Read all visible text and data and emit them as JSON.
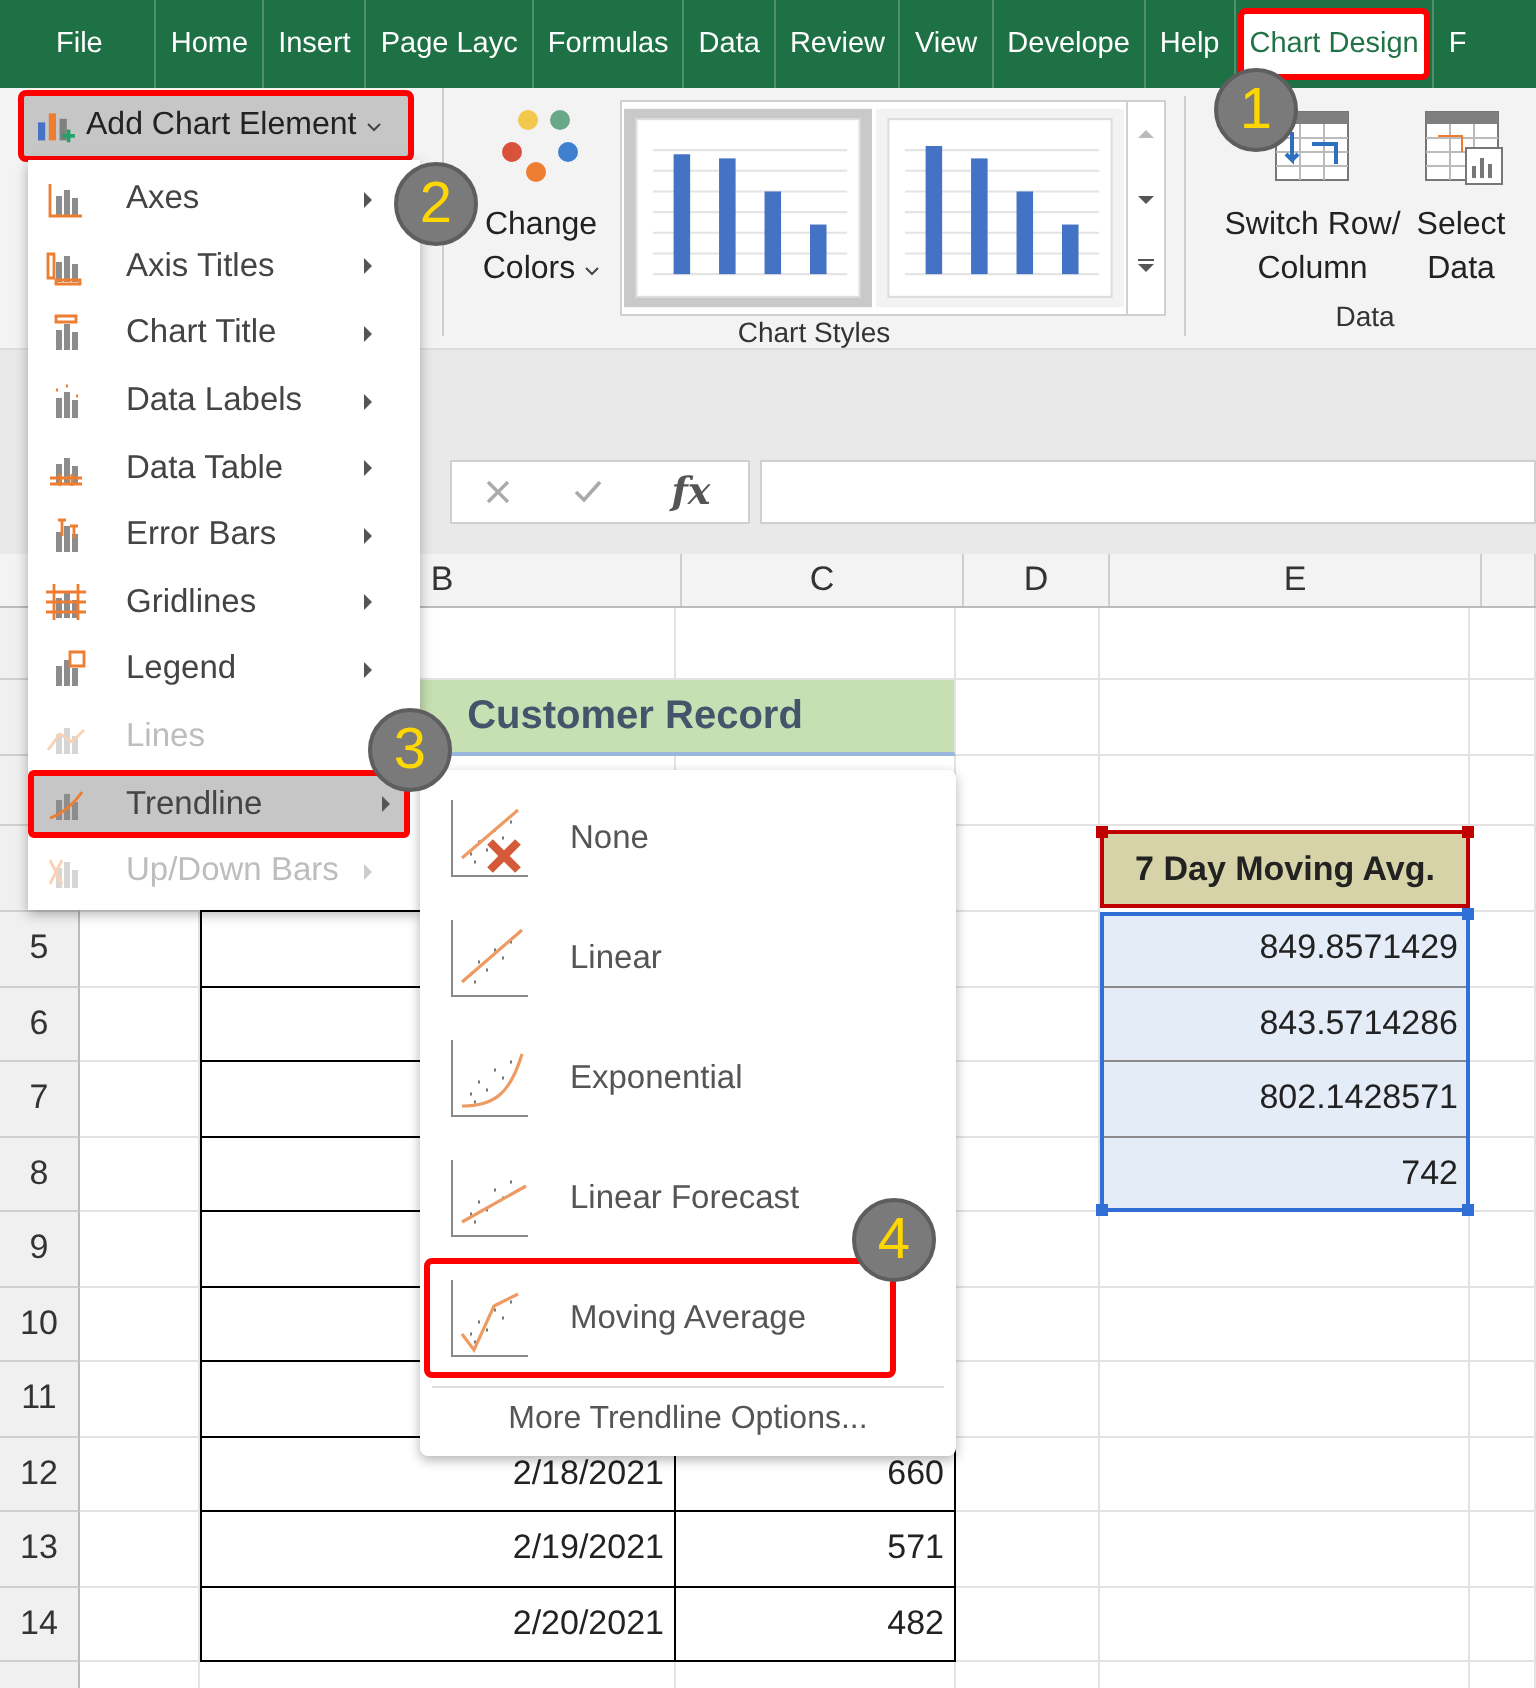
{
  "ribbon_tabs": [
    {
      "label": "File",
      "selected": false,
      "highlighted": false
    },
    {
      "label": "Home",
      "selected": false,
      "highlighted": false
    },
    {
      "label": "Insert",
      "selected": false,
      "highlighted": false
    },
    {
      "label": "Page Layc",
      "selected": false,
      "highlighted": false
    },
    {
      "label": "Formulas",
      "selected": false,
      "highlighted": false
    },
    {
      "label": "Data",
      "selected": false,
      "highlighted": false
    },
    {
      "label": "Review",
      "selected": false,
      "highlighted": false
    },
    {
      "label": "View",
      "selected": false,
      "highlighted": false
    },
    {
      "label": "Develope",
      "selected": false,
      "highlighted": false
    },
    {
      "label": "Help",
      "selected": false,
      "highlighted": false
    },
    {
      "label": "Chart Design",
      "selected": true,
      "highlighted": true
    },
    {
      "label": "F",
      "selected": false,
      "highlighted": false
    }
  ],
  "ribbon": {
    "add_chart_element": {
      "label": "Add Chart Element",
      "highlighted": true
    },
    "change_colors": {
      "label_lines": [
        "Change",
        "Colors"
      ]
    },
    "chart_styles": {
      "label": "Chart Styles",
      "styles": [
        {
          "selected": true
        },
        {
          "selected": false
        }
      ]
    },
    "data_group": {
      "label": "Data",
      "buttons": [
        {
          "label_lines": [
            "Switch Row/",
            "Column"
          ]
        },
        {
          "label_lines": [
            "Select",
            "Data"
          ]
        }
      ]
    }
  },
  "formula_bar": {
    "function_label": "fx"
  },
  "sheet": {
    "columns": [
      "B",
      "C",
      "D",
      "E"
    ],
    "title": "Customer Record",
    "avg_header": "7 Day Moving Avg.",
    "rows": [
      {
        "row": "5",
        "E": "849.8571429"
      },
      {
        "row": "6",
        "E": "843.5714286"
      },
      {
        "row": "7",
        "E": "802.1428571"
      },
      {
        "row": "8",
        "E": "742"
      },
      {
        "row": "9"
      },
      {
        "row": "10"
      },
      {
        "row": "11"
      },
      {
        "row": "12",
        "B": "2/18/2021",
        "C": "660"
      },
      {
        "row": "13",
        "B": "2/19/2021",
        "C": "571"
      },
      {
        "row": "14",
        "B": "2/20/2021",
        "C": "482"
      }
    ]
  },
  "add_chart_element_menu": {
    "items": [
      {
        "label": "Axes",
        "disabled": false,
        "selected": false,
        "has_submenu": true
      },
      {
        "label": "Axis Titles",
        "disabled": false,
        "selected": false,
        "has_submenu": true
      },
      {
        "label": "Chart Title",
        "disabled": false,
        "selected": false,
        "has_submenu": true
      },
      {
        "label": "Data Labels",
        "disabled": false,
        "selected": false,
        "has_submenu": true
      },
      {
        "label": "Data Table",
        "disabled": false,
        "selected": false,
        "has_submenu": true
      },
      {
        "label": "Error Bars",
        "disabled": false,
        "selected": false,
        "has_submenu": true
      },
      {
        "label": "Gridlines",
        "disabled": false,
        "selected": false,
        "has_submenu": true
      },
      {
        "label": "Legend",
        "disabled": false,
        "selected": false,
        "has_submenu": true
      },
      {
        "label": "Lines",
        "disabled": true,
        "selected": false,
        "has_submenu": false
      },
      {
        "label": "Trendline",
        "disabled": false,
        "selected": true,
        "has_submenu": true
      },
      {
        "label": "Up/Down Bars",
        "disabled": true,
        "selected": false,
        "has_submenu": true
      }
    ]
  },
  "trendline_menu": {
    "items": [
      {
        "label": "None",
        "highlighted": false
      },
      {
        "label": "Linear",
        "highlighted": false
      },
      {
        "label": "Exponential",
        "highlighted": false
      },
      {
        "label": "Linear Forecast",
        "highlighted": false
      },
      {
        "label": "Moving Average",
        "highlighted": true
      }
    ],
    "more_options": "More Trendline Options..."
  },
  "callouts": [
    "1",
    "2",
    "3",
    "4"
  ]
}
